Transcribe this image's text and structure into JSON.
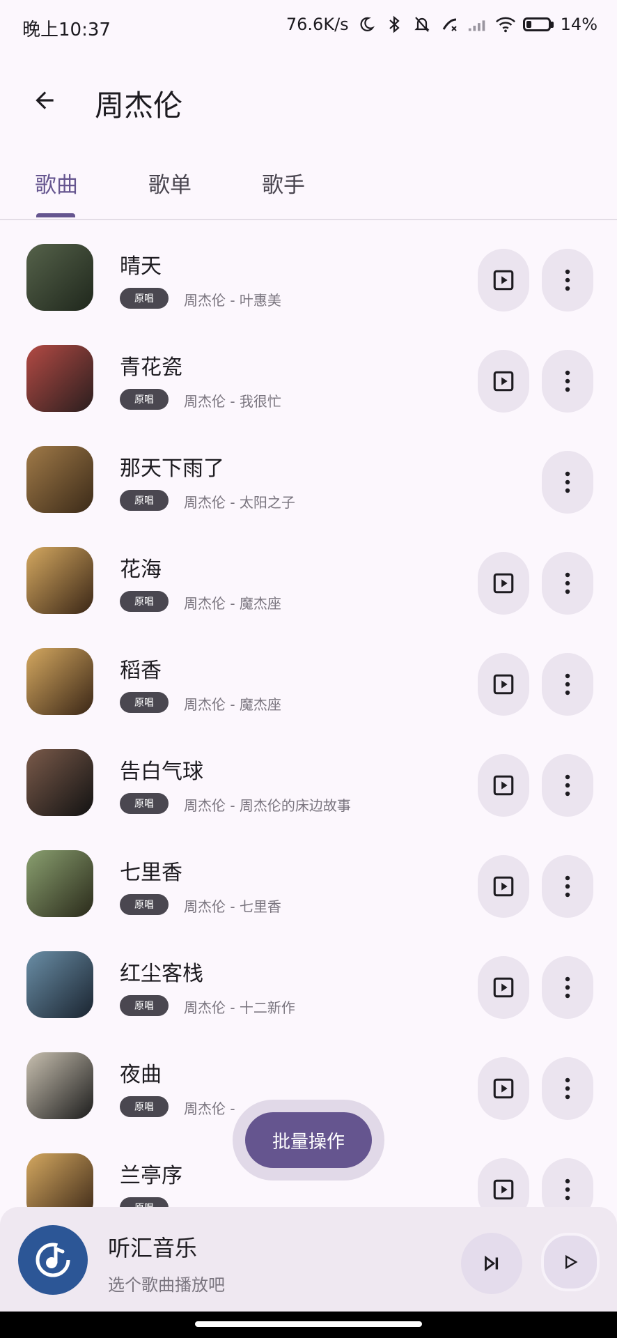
{
  "status_bar": {
    "time": "晚上10:37",
    "network_speed": "76.6K/s",
    "battery": "14%",
    "icons": [
      "moon-icon",
      "bluetooth-icon",
      "mute-bell-icon",
      "call-icon",
      "signal-icon",
      "wifi-icon",
      "battery-charging-icon"
    ]
  },
  "header": {
    "title": "周杰伦",
    "back_icon": "arrow-left-icon"
  },
  "tabs": [
    {
      "label": "歌曲",
      "selected": true
    },
    {
      "label": "歌单",
      "selected": false
    },
    {
      "label": "歌手",
      "selected": false
    }
  ],
  "songs": [
    {
      "title": "晴天",
      "tag": "原唱",
      "subtitle": "周杰伦 - 叶惠美",
      "has_play": true,
      "cover_color": "#2e3b2a"
    },
    {
      "title": "青花瓷",
      "tag": "原唱",
      "subtitle": "周杰伦 - 我很忙",
      "has_play": true,
      "cover_color": "#8a3f3a"
    },
    {
      "title": "那天下雨了",
      "tag": "原唱",
      "subtitle": "周杰伦 - 太阳之子",
      "has_play": false,
      "cover_color": "#6b4e2e"
    },
    {
      "title": "花海",
      "tag": "原唱",
      "subtitle": "周杰伦 - 魔杰座",
      "has_play": true,
      "cover_color": "#8d6a3a"
    },
    {
      "title": "稻香",
      "tag": "原唱",
      "subtitle": "周杰伦 - 魔杰座",
      "has_play": true,
      "cover_color": "#8d6a3a"
    },
    {
      "title": "告白气球",
      "tag": "原唱",
      "subtitle": "周杰伦 - 周杰伦的床边故事",
      "has_play": true,
      "cover_color": "#3a3a3a"
    },
    {
      "title": "七里香",
      "tag": "原唱",
      "subtitle": "周杰伦 - 七里香",
      "has_play": true,
      "cover_color": "#3f4a32"
    },
    {
      "title": "红尘客栈",
      "tag": "原唱",
      "subtitle": "周杰伦 - 十二新作",
      "has_play": true,
      "cover_color": "#2f4150"
    },
    {
      "title": "夜曲",
      "tag": "原唱",
      "subtitle": "周杰伦 -",
      "has_play": true,
      "cover_color": "#2a2a2a"
    },
    {
      "title": "兰亭序",
      "tag": "原唱",
      "subtitle": "",
      "has_play": true,
      "cover_color": "#8d6a3a"
    }
  ],
  "fab": {
    "label": "批量操作"
  },
  "player": {
    "title": "听汇音乐",
    "subtitle": "选个歌曲播放吧",
    "logo_icon": "music-note-icon",
    "next_icon": "skip-next-icon",
    "play_icon": "play-icon"
  },
  "colors": {
    "background": "#fcf7fd",
    "accent": "#65558f",
    "button_bg": "#ebe4ef",
    "logo_bg": "#2c5696"
  }
}
